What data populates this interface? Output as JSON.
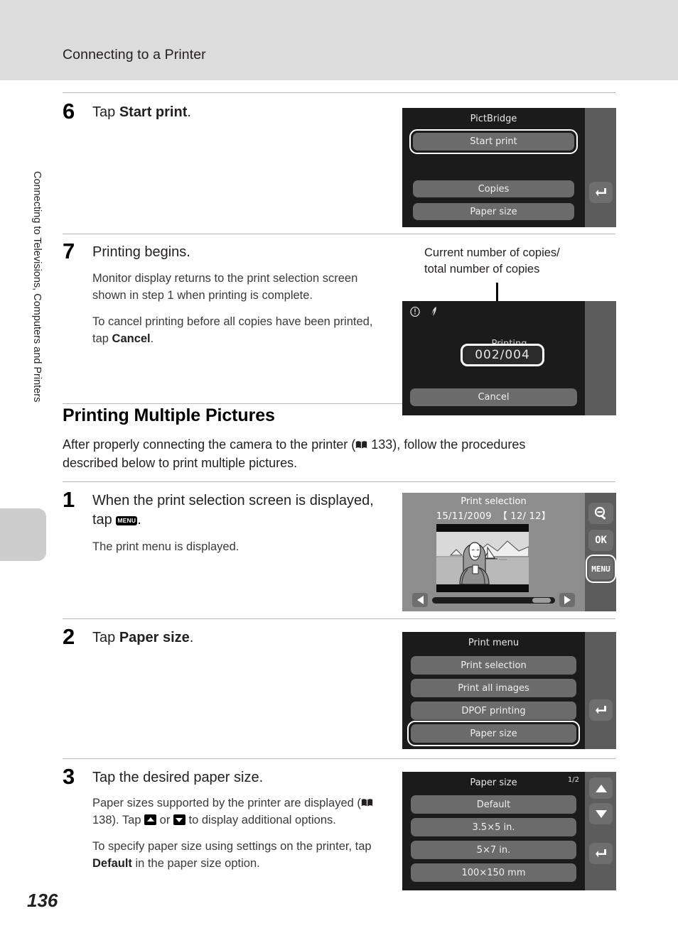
{
  "header": {
    "title": "Connecting to a Printer"
  },
  "sidebar": {
    "vertical_text": "Connecting to Televisions, Computers and Printers"
  },
  "footer": {
    "page_number": "136"
  },
  "steps": [
    {
      "number": "6",
      "title_prefix": "Tap ",
      "title_bold": "Start print",
      "title_suffix": "."
    },
    {
      "number": "7",
      "title": "Printing begins.",
      "para1": "Monitor display returns to the print selection screen shown in step 1 when printing is complete.",
      "para2_prefix": "To cancel printing before all copies have been printed, tap ",
      "para2_bold": "Cancel",
      "para2_suffix": "."
    },
    {
      "number": "1",
      "title_prefix": "When the print selection screen is displayed, tap ",
      "title_icon": "menu-icon",
      "title_icon_label": "MENU",
      "title_suffix": ".",
      "body": "The print menu is displayed."
    },
    {
      "number": "2",
      "title_prefix": "Tap ",
      "title_bold": "Paper size",
      "title_suffix": "."
    },
    {
      "number": "3",
      "title": "Tap the desired paper size.",
      "para1_a": "Paper sizes supported by the printer are displayed (",
      "para1_ref": "138). Tap ",
      "para1_b": " or ",
      "para1_c": " to display additional options.",
      "para2_a": "To specify paper size using settings on the printer, tap ",
      "para2_bold": "Default",
      "para2_b": " in the paper size option."
    }
  ],
  "section": {
    "heading": "Printing Multiple Pictures",
    "intro_a": "After properly connecting the camera to the printer (",
    "intro_ref": "133), follow the procedures described below to print multiple pictures."
  },
  "callout": {
    "line1": "Current number of copies/",
    "line2": "total number of copies"
  },
  "screens": {
    "pictbridge": {
      "title": "PictBridge",
      "selected_button": "Start print",
      "buttons": [
        "Copies",
        "Paper size"
      ],
      "rail_icon": "back-icon"
    },
    "printing": {
      "status_label": "Printing",
      "copy_counter": "002/004",
      "cancel_label": "Cancel",
      "warning_icons": "clock-icon flash-icon"
    },
    "print_selection": {
      "title": "Print selection",
      "date": "15/11/2009",
      "counter": "【  12/   12】",
      "rail_buttons": [
        "zoom-out-icon",
        "ok-icon",
        "menu-icon"
      ],
      "ok_label": "OK",
      "menu_label": "MENU"
    },
    "print_menu": {
      "title": "Print menu",
      "items": [
        "Print selection",
        "Print all images",
        "DPOF printing"
      ],
      "selected_item": "Paper size",
      "rail_icon": "back-icon"
    },
    "paper_size": {
      "title": "Paper size",
      "page_indicator": "1/2",
      "items": [
        "Default",
        "3.5×5 in.",
        "5×7 in.",
        "100×150 mm"
      ],
      "rail_icons": [
        "up-arrow-icon",
        "down-arrow-icon",
        "back-icon"
      ]
    }
  },
  "colors": {
    "header_band": "#dcdcdc",
    "screen_bg": "#1b1b1b",
    "rail": "#5c5c5c",
    "button": "#6b6b6b",
    "text_light": "#f0f0f0"
  }
}
